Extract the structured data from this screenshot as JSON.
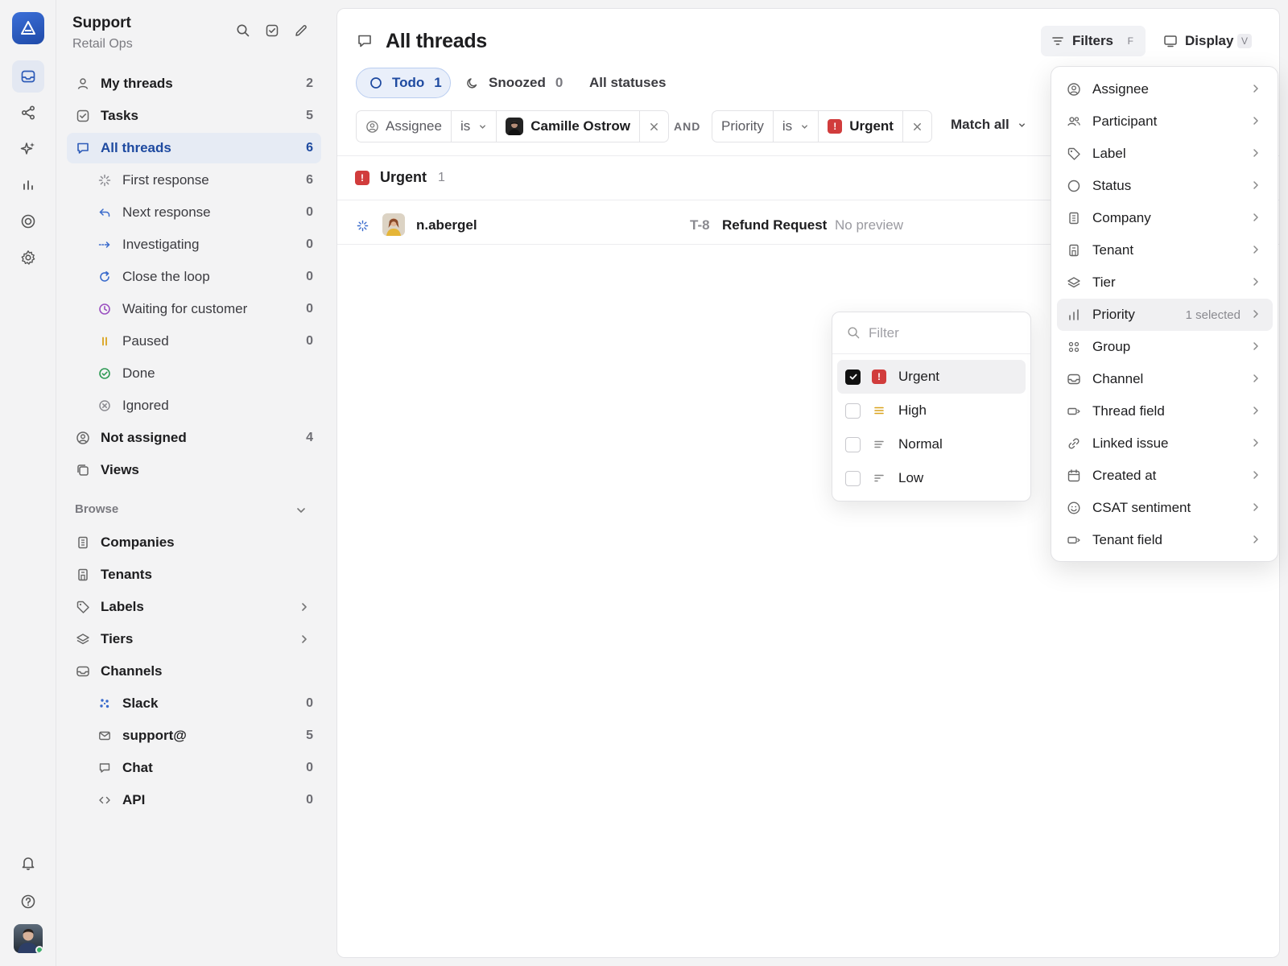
{
  "workspace": {
    "name": "Support",
    "team": "Retail Ops"
  },
  "sidebar": {
    "items": [
      {
        "label": "My threads",
        "count": "2"
      },
      {
        "label": "Tasks",
        "count": "5"
      },
      {
        "label": "All threads",
        "count": "6"
      },
      {
        "label": "First response",
        "count": "6"
      },
      {
        "label": "Next response",
        "count": "0"
      },
      {
        "label": "Investigating",
        "count": "0"
      },
      {
        "label": "Close the loop",
        "count": "0"
      },
      {
        "label": "Waiting for customer",
        "count": "0"
      },
      {
        "label": "Paused",
        "count": "0"
      },
      {
        "label": "Done"
      },
      {
        "label": "Ignored"
      },
      {
        "label": "Not assigned",
        "count": "4"
      },
      {
        "label": "Views"
      }
    ],
    "browse_label": "Browse",
    "browse": [
      {
        "label": "Companies"
      },
      {
        "label": "Tenants"
      },
      {
        "label": "Labels"
      },
      {
        "label": "Tiers"
      },
      {
        "label": "Channels"
      },
      {
        "label": "Slack",
        "count": "0"
      },
      {
        "label": "support@",
        "count": "5"
      },
      {
        "label": "Chat",
        "count": "0"
      },
      {
        "label": "API",
        "count": "0"
      }
    ]
  },
  "main": {
    "title": "All threads",
    "filters_btn": {
      "label": "Filters",
      "key": "F"
    },
    "display_btn": {
      "label": "Display",
      "key": "V"
    },
    "tabs": [
      {
        "label": "Todo",
        "count": "1"
      },
      {
        "label": "Snoozed",
        "count": "0"
      },
      {
        "label": "All statuses"
      }
    ],
    "filter1": {
      "field": "Assignee",
      "op": "is",
      "value": "Camille Ostrow"
    },
    "and_label": "AND",
    "filter2": {
      "field": "Priority",
      "op": "is",
      "value": "Urgent"
    },
    "match_label": "Match all",
    "group": {
      "label": "Urgent",
      "count": "1"
    },
    "thread": {
      "author": "n.abergel",
      "id": "T-8",
      "subject": "Refund Request",
      "preview": "No preview"
    }
  },
  "priority_popover": {
    "search_placeholder": "Filter",
    "options": [
      {
        "label": "Urgent",
        "checked": true
      },
      {
        "label": "High",
        "checked": false
      },
      {
        "label": "Normal",
        "checked": false
      },
      {
        "label": "Low",
        "checked": false
      }
    ]
  },
  "filters_menu": {
    "items": [
      {
        "label": "Assignee",
        "icon": "user-circle-icon"
      },
      {
        "label": "Participant",
        "icon": "users-icon"
      },
      {
        "label": "Label",
        "icon": "tag-icon"
      },
      {
        "label": "Status",
        "icon": "circle-icon"
      },
      {
        "label": "Company",
        "icon": "building-icon"
      },
      {
        "label": "Tenant",
        "icon": "tenant-icon"
      },
      {
        "label": "Tier",
        "icon": "layers-icon"
      },
      {
        "label": "Priority",
        "icon": "bars-icon",
        "note": "1 selected"
      },
      {
        "label": "Group",
        "icon": "grid-dots-icon"
      },
      {
        "label": "Channel",
        "icon": "inbox-icon"
      },
      {
        "label": "Thread field",
        "icon": "field-icon"
      },
      {
        "label": "Linked issue",
        "icon": "link-icon"
      },
      {
        "label": "Created at",
        "icon": "calendar-icon"
      },
      {
        "label": "CSAT sentiment",
        "icon": "smile-icon"
      },
      {
        "label": "Tenant field",
        "icon": "field-icon"
      }
    ]
  },
  "colors": {
    "accent": "#1e4aa0",
    "urgent": "#d13c3c",
    "high": "#d9a21b"
  }
}
